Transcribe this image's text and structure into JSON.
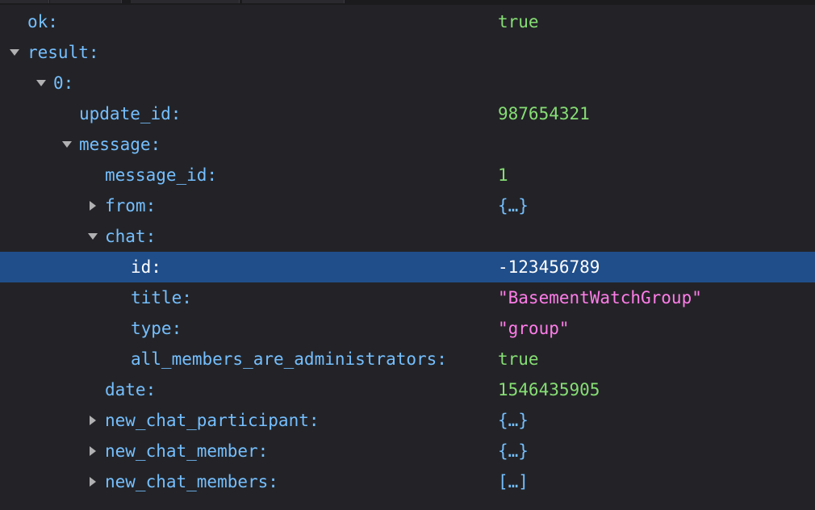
{
  "rows": [
    {
      "key": "ok:",
      "value": "true"
    },
    {
      "key": "result:",
      "value": ""
    },
    {
      "key": "0:",
      "value": ""
    },
    {
      "key": "update_id:",
      "value": "987654321"
    },
    {
      "key": "message:",
      "value": ""
    },
    {
      "key": "message_id:",
      "value": "1"
    },
    {
      "key": "from:",
      "value": "{…}"
    },
    {
      "key": "chat:",
      "value": ""
    },
    {
      "key": "id:",
      "value": "-123456789"
    },
    {
      "key": "title:",
      "value": "\"BasementWatchGroup\""
    },
    {
      "key": "type:",
      "value": "\"group\""
    },
    {
      "key": "all_members_are_administrators:",
      "value": "true"
    },
    {
      "key": "date:",
      "value": "1546435905"
    },
    {
      "key": "new_chat_participant:",
      "value": "{…}"
    },
    {
      "key": "new_chat_member:",
      "value": "{…}"
    },
    {
      "key": "new_chat_members:",
      "value": "[…]"
    }
  ],
  "colors": {
    "background": "#232327",
    "key": "#75bfff",
    "number_bool": "#86de74",
    "string": "#ff7de9",
    "selection": "#204e8a",
    "twisty": "#b1b1b3"
  }
}
